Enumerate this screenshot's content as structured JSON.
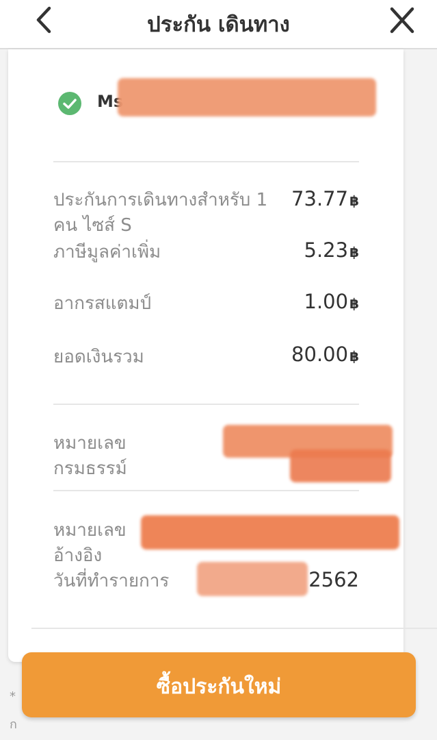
{
  "header": {
    "title": "ประกัน เดินทาง",
    "back_icon": "chevron-left-icon",
    "close_icon": "close-icon"
  },
  "receipt": {
    "name_prefix": "Ms",
    "items": [
      {
        "label_line1": "ประกันการเดินทางสำหรับ 1",
        "label_line2": "คน ไซส์ S",
        "amount": "73.77"
      },
      {
        "label": "ภาษีมูลค่าเพิ่ม",
        "amount": "5.23"
      },
      {
        "label": "อากรสแตมป์",
        "amount": "1.00"
      },
      {
        "label": "ยอดเงินรวม",
        "amount": "80.00"
      }
    ],
    "currency": "฿",
    "policy_number_label_line1": "หมายเลข",
    "policy_number_label_line2": "กรมธรรม์",
    "reference_label_line1": "หมายเลข",
    "reference_label_line2": "อ้างอิง",
    "transaction_date_label": "วันที่ทำรายการ",
    "transaction_date_year": "2562"
  },
  "footer_note": {
    "line1": "*",
    "line2": "ก"
  },
  "actions": {
    "buy_new_label": "ซื้อประกันใหม่"
  },
  "colors": {
    "accent": "#f09a37",
    "check": "#5cb871",
    "redaction": "#ee7f50"
  }
}
